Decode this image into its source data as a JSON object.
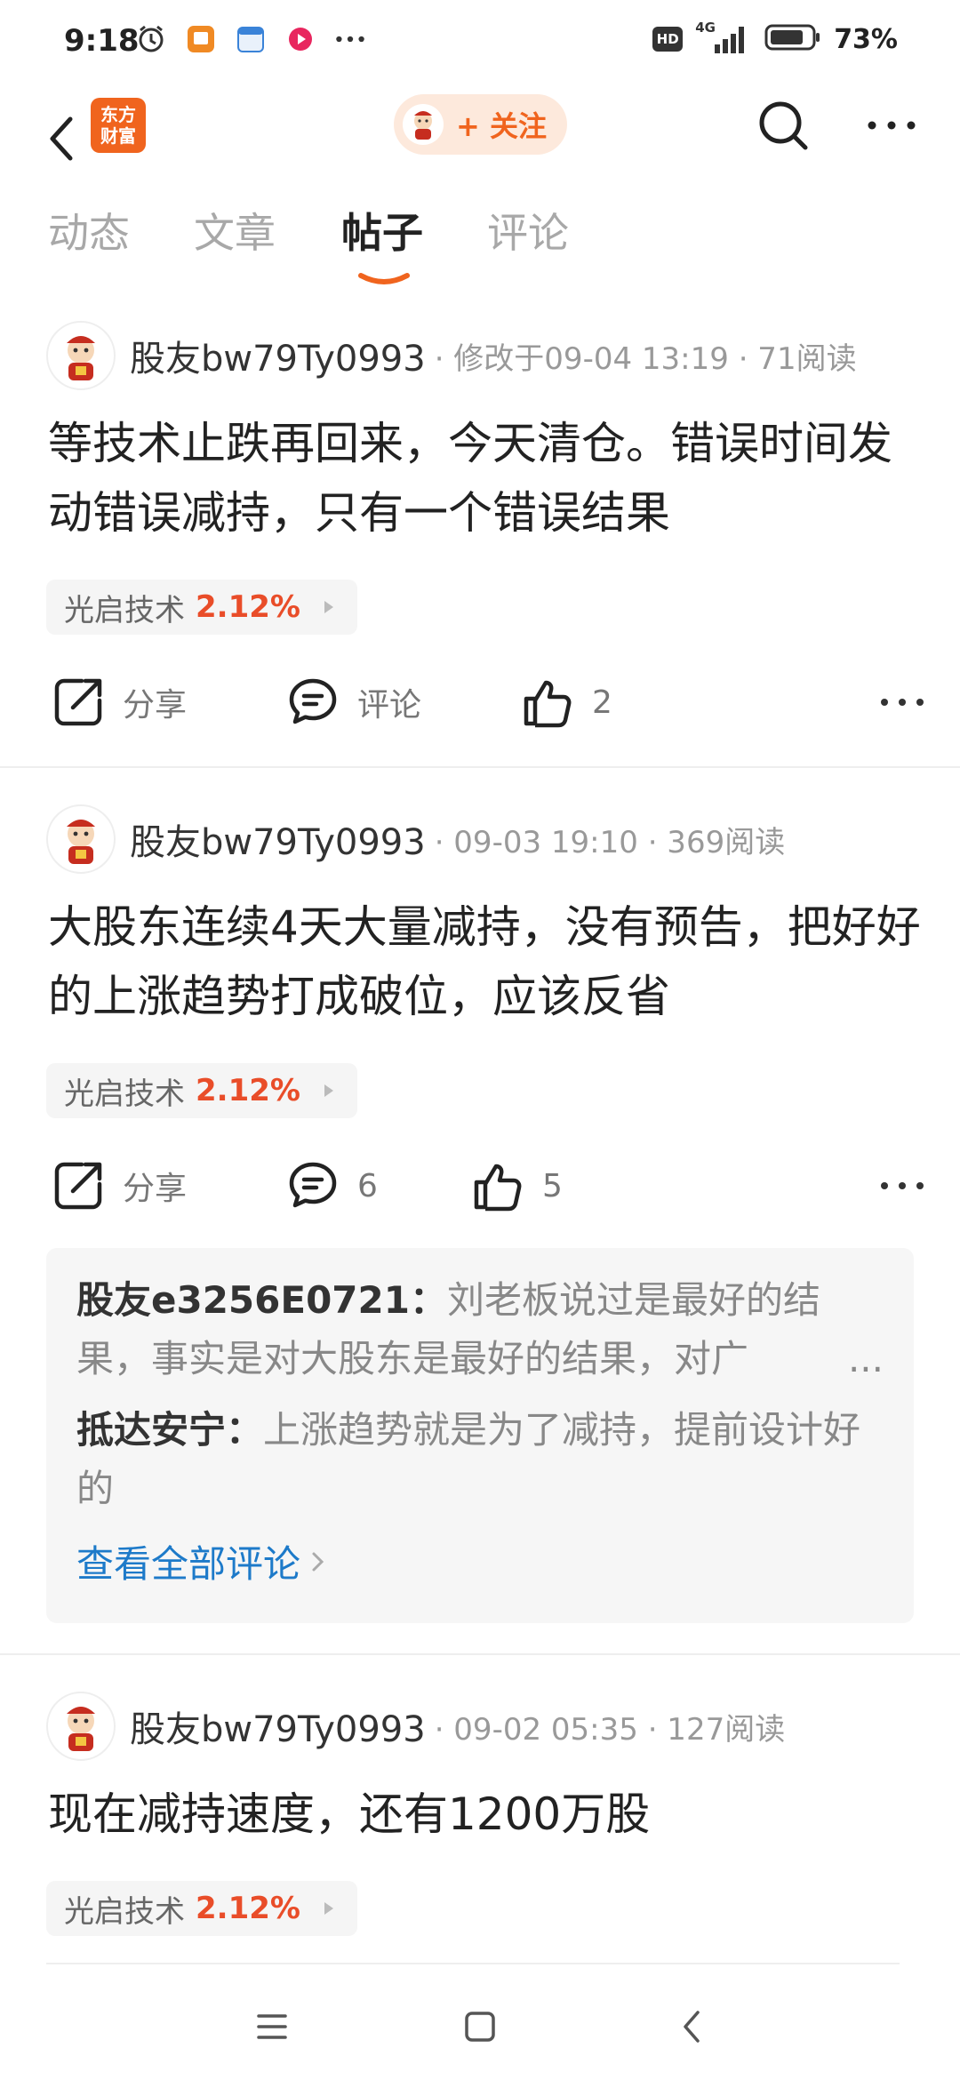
{
  "status_bar": {
    "time": "9:18",
    "network": "4G",
    "hd": "HD",
    "battery_percent": "73%"
  },
  "header": {
    "logo_text_line1": "东方",
    "logo_text_line2": "财富",
    "follow_label": "+ 关注"
  },
  "tabs": [
    {
      "label": "动态"
    },
    {
      "label": "文章"
    },
    {
      "label": "帖子"
    },
    {
      "label": "评论"
    }
  ],
  "active_tab": "帖子",
  "colors": {
    "accent": "#f0641e",
    "stock_up": "#e94d29",
    "link": "#1d7ac9"
  },
  "posts": [
    {
      "author": "股友bw79Ty0993",
      "meta": "· 修改于09-04 13:19 · 71阅读",
      "text": "等技术止跌再回来，今天清仓。错误时间发动错误减持，只有一个错误结果",
      "stock_name": "光启技术",
      "stock_change": "2.12%",
      "share_label": "分享",
      "comment_label": "评论",
      "like_count": "2"
    },
    {
      "author": "股友bw79Ty0993",
      "meta": "· 09-03 19:10 · 369阅读",
      "text": "大股东连续4天大量减持，没有预告，把好好的上涨趋势打成破位，应该反省",
      "stock_name": "光启技术",
      "stock_change": "2.12%",
      "share_label": "分享",
      "comment_count": "6",
      "like_count": "5",
      "comments": [
        {
          "user": "股友e3256E0721：",
          "text": "刘老板说过是最好的结果，事实是对大股东是最好的结果，对广",
          "ellipsis": "..."
        },
        {
          "user": "抵达安宁：",
          "text": "上涨趋势就是为了减持，提前设计好的"
        }
      ],
      "view_all": "查看全部评论"
    },
    {
      "author": "股友bw79Ty0993",
      "meta": "· 09-02 05:35 · 127阅读",
      "text": "现在减持速度，还有1200万股",
      "stock_name": "光启技术",
      "stock_change": "2.12%"
    }
  ]
}
